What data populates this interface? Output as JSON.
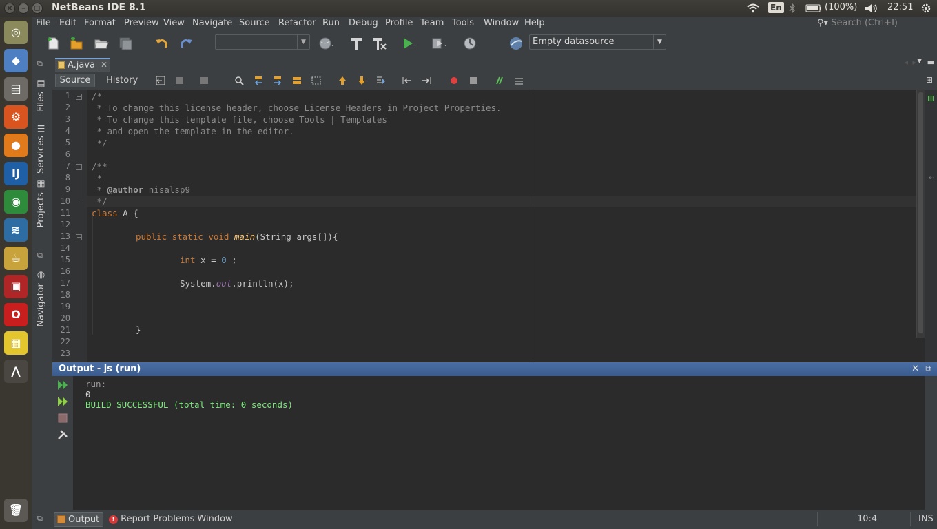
{
  "app": {
    "title": "NetBeans IDE 8.1"
  },
  "tray": {
    "lang": "En",
    "battery": "(100%)",
    "clock": "22:51"
  },
  "menu": [
    "File",
    "Edit",
    "Format",
    "Preview",
    "View",
    "Navigate",
    "Source",
    "Refactor",
    "Run",
    "Debug",
    "Profile",
    "Team",
    "Tools",
    "Window",
    "Help"
  ],
  "search": {
    "placeholder": "Search (Ctrl+I)"
  },
  "toolbar": {
    "config_value": "",
    "datasource": "Empty datasource"
  },
  "side_tabs": [
    "Files",
    "Services",
    "Projects",
    "Navigator"
  ],
  "editor": {
    "file_tab": "A.java",
    "source_tab": "Source",
    "history_tab": "History",
    "line_numbers": [
      "1",
      "2",
      "3",
      "4",
      "5",
      "6",
      "7",
      "8",
      "9",
      "10",
      "11",
      "12",
      "13",
      "14",
      "15",
      "16",
      "17",
      "18",
      "19",
      "20",
      "21",
      "22",
      "23"
    ],
    "code": {
      "l1": "/*",
      "l2": " * To change this license header, choose License Headers in Project Properties.",
      "l3": " * To change this template file, choose Tools | Templates",
      "l4": " * and open the template in the editor.",
      "l5": " */",
      "l7": "/**",
      "l8": " *",
      "l9_pre": " * ",
      "l9_tag": "@author",
      "l9_name": " nisalsp9",
      "l10": " */",
      "l11_kw": "class",
      "l11_rest": " A {",
      "l13_kw": "public static void",
      "l13_fn": "main",
      "l13_rest": "(String args[]){",
      "l15_kw": "int",
      "l15_mid": " x = ",
      "l15_num": "0",
      "l15_end": " ;",
      "l17_a": "System.",
      "l17_fld": "out",
      "l17_b": ".println(x);",
      "l21": "}"
    }
  },
  "output": {
    "title": "Output - js (run)",
    "lines": [
      "run:",
      "0",
      "BUILD SUCCESSFUL (total time: 0 seconds)"
    ],
    "colors": {
      "normal": "#bbbbbb",
      "success": "#7ee87e"
    }
  },
  "status": {
    "output_tab": "Output",
    "report_problems": "Report Problems Window",
    "position": "10:4",
    "mode": "INS"
  },
  "colors": {
    "accent": "#4a6fa5",
    "keyword": "#cc7832",
    "number": "#6897bb",
    "method": "#ffc66d",
    "comment": "#8c8c8c"
  }
}
